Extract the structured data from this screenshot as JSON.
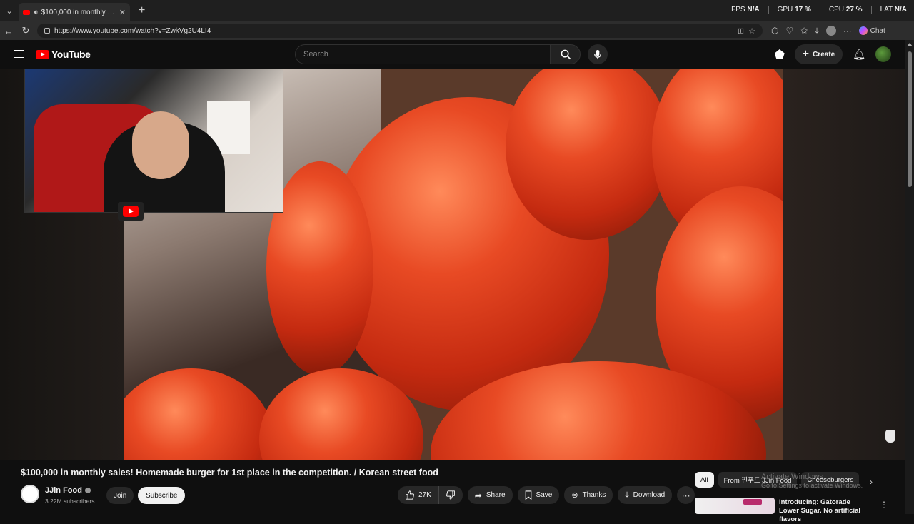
{
  "browser": {
    "tab_title": "$100,000 in monthly sales! Ho",
    "url": "https://www.youtube.com/watch?v=ZwkVg2U4LI4",
    "chat_label": "Chat",
    "perf": {
      "fps_label": "FPS",
      "fps_value": "N/A",
      "gpu_label": "GPU",
      "gpu_value": "17 %",
      "cpu_label": "CPU",
      "cpu_value": "27 %",
      "lat_label": "LAT",
      "lat_value": "N/A"
    }
  },
  "youtube": {
    "logo_text": "YouTube",
    "search_placeholder": "Search",
    "create_label": "Create"
  },
  "video": {
    "title": "$100,000 in monthly sales! Homemade burger for 1st place in the competition. / Korean street food",
    "channel": "JJin Food",
    "subscribers": "3.22M subscribers",
    "join_label": "Join",
    "subscribe_label": "Subscribe",
    "likes": "27K",
    "share_label": "Share",
    "save_label": "Save",
    "thanks_label": "Thanks",
    "download_label": "Download"
  },
  "sidebar": {
    "chips": [
      "All",
      "From 찐푸드 JJin Food",
      "Cheeseburgers"
    ],
    "recommendation_title": "Introducing: Gatorade Lower Sugar. No artificial flavors"
  },
  "windows_watermark": {
    "line1": "Activate Windows",
    "line2": "Go to Settings to activate Windows."
  }
}
